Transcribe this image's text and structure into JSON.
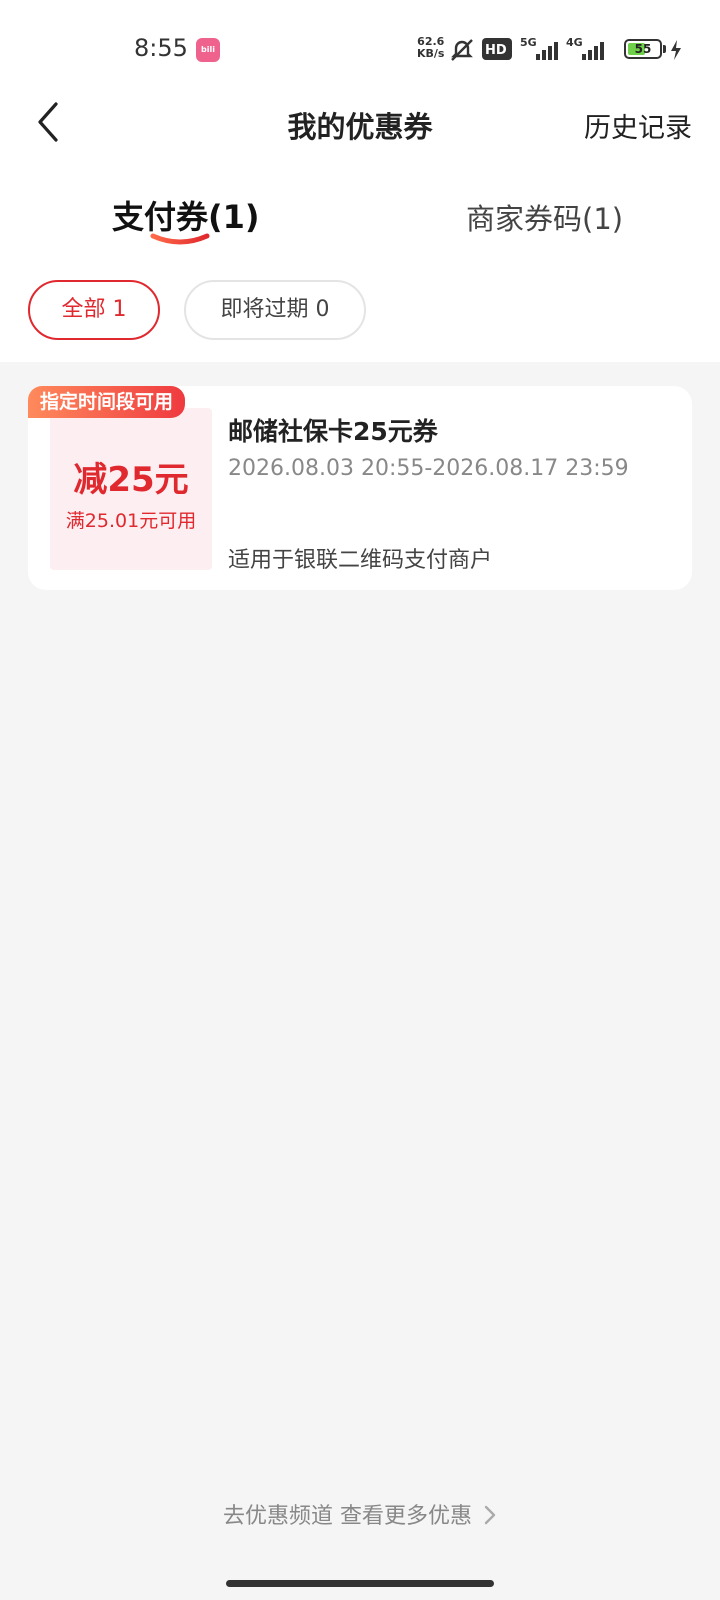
{
  "status_bar": {
    "time": "8:55",
    "app_badge": "bili",
    "net_speed_value": "62.6",
    "net_speed_unit": "KB/s",
    "hd_label": "HD",
    "net_5g": "5G",
    "net_4g": "4G",
    "battery": "55",
    "battery_level": 0.55,
    "icons": [
      "mute-icon",
      "hd-icon",
      "signal-5g-icon",
      "signal-4g-icon",
      "battery-icon",
      "charging-icon"
    ]
  },
  "header": {
    "title": "我的优惠券",
    "history_label": "历史记录"
  },
  "tabs": [
    {
      "label": "支付券(1)",
      "active": true
    },
    {
      "label": "商家券码(1)",
      "active": false
    }
  ],
  "filters": [
    {
      "label": "全部 1",
      "active": true
    },
    {
      "label": "即将过期 0",
      "active": false
    }
  ],
  "coupon": {
    "tag": "指定时间段可用",
    "amount": "减25元",
    "threshold": "满25.01元可用",
    "title": "邮储社保卡25元券",
    "validity": "2026.08.03 20:55-2026.08.17 23:59",
    "scope": "适用于银联二维码支付商户"
  },
  "footer": {
    "more_link": "去优惠频道 查看更多优惠"
  },
  "colors": {
    "accent": "#e0292f",
    "tag_gradient_start": "#ff8a5c",
    "tag_gradient_end": "#ef3a3f",
    "amount_bg": "#fdeff1",
    "page_bg": "#f5f5f5"
  }
}
